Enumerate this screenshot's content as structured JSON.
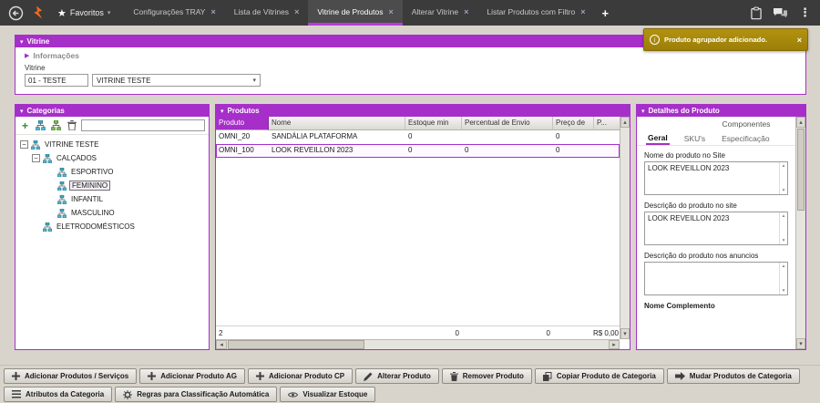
{
  "icons": {
    "star": "★",
    "caret_down": "▾",
    "kebab": "⋮",
    "plus": "+",
    "close": "×",
    "collapse": "▾",
    "arrow_right": "▶",
    "minus": "−",
    "scroll_up": "▴",
    "scroll_down": "▾",
    "scroll_left": "◂",
    "scroll_right": "▸",
    "info": "i"
  },
  "colors": {
    "accent_purple": "#a62fc9",
    "toast_gold": "#a8890f",
    "topbar_gray": "#3b3b3b",
    "logo_orange": "#f26a21"
  },
  "topbar": {
    "favorites_label": "Favoritos",
    "tabs": [
      {
        "label": "Configurações TRAY"
      },
      {
        "label": "Lista de Vitrines"
      },
      {
        "label": "Vitrine de Produtos"
      },
      {
        "label": "Alterar Vitrine"
      },
      {
        "label": "Listar Produtos com Filtro"
      }
    ]
  },
  "toast": {
    "message": "Produto agrupador adicionado."
  },
  "vitrine": {
    "header": "Vitrine",
    "info_label": "Informações",
    "field_label": "Vitrine",
    "code": "01 - TESTE",
    "name": "VITRINE TESTE"
  },
  "categories": {
    "header": "Categorias",
    "search_value": "",
    "tree": [
      {
        "label": "VITRINE TESTE"
      },
      {
        "label": "CALÇADOS"
      },
      {
        "label": "ESPORTIVO"
      },
      {
        "label": "FEMININO"
      },
      {
        "label": "INFANTIL"
      },
      {
        "label": "MASCULINO"
      },
      {
        "label": "ELETRODOMÉSTICOS"
      }
    ]
  },
  "products": {
    "header": "Produtos",
    "columns": [
      "Produto",
      "Nome",
      "Estoque min",
      "Percentual de Envio",
      "Preço de",
      "P..."
    ],
    "rows": [
      {
        "cells": [
          "OMNI_20",
          "SANDÁLIA PLATAFORMA",
          "0",
          "",
          "0",
          ""
        ]
      },
      {
        "cells": [
          "OMNI_100",
          "LOOK REVEILLON 2023",
          "0",
          "0",
          "0",
          ""
        ]
      }
    ],
    "summary": {
      "count": "2",
      "estoque": "0",
      "percentual": "0",
      "total": "R$ 0,00"
    }
  },
  "details": {
    "header": "Detalhes do Produto",
    "tab_componentes": "Componentes",
    "tab_geral": "Geral",
    "tab_skus": "SKU's",
    "tab_especificacao": "Especificação",
    "fields": [
      {
        "label": "Nome do produto no Site",
        "value": "LOOK REVEILLON 2023"
      },
      {
        "label": "Descrição do produto no site",
        "value": "LOOK REVEILLON 2023"
      },
      {
        "label": "Descrição do produto nos anuncios",
        "value": ""
      }
    ],
    "last_label": "Nome Complemento"
  },
  "actions": {
    "row1": [
      "Adicionar Produtos / Serviços",
      "Adicionar Produto AG",
      "Adicionar Produto CP",
      "Alterar Produto",
      "Remover Produto",
      "Copiar Produto de Categoria",
      "Mudar Produtos de Categoria"
    ],
    "row2": [
      "Atributos da Categoria",
      "Regras para Classificação Automática",
      "Visualizar Estoque"
    ]
  }
}
